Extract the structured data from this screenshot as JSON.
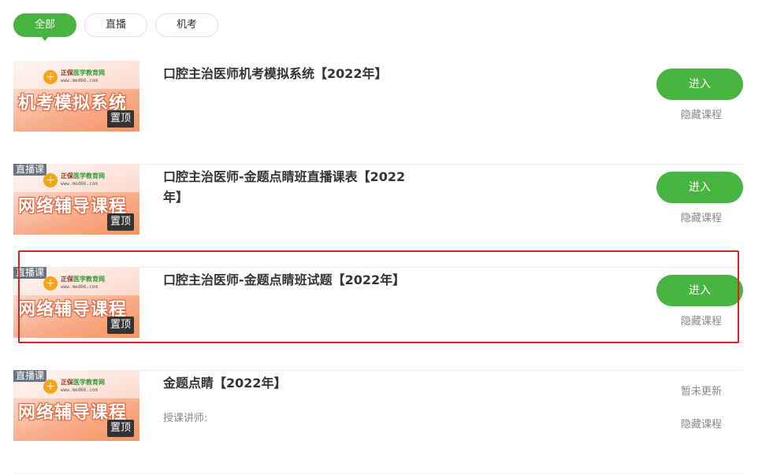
{
  "tabs": [
    {
      "label": "全部",
      "active": true
    },
    {
      "label": "直播",
      "active": false
    },
    {
      "label": "机考",
      "active": false
    }
  ],
  "thumbnail": {
    "logo_text_a": "正保",
    "logo_text_b": "医学教育网",
    "logo_url": "www.med66.com",
    "top_badge": "置顶",
    "live_badge": "直播课"
  },
  "courses": [
    {
      "title": "口腔主治医师机考模拟系统【2022年】",
      "thumb_text": "机考模拟系统",
      "live": false,
      "action": "进入",
      "hide": "隐藏课程"
    },
    {
      "title": "口腔主治医师-金题点睛班直播课表【2022年】",
      "thumb_text": "网络辅导课程",
      "live": true,
      "action": "进入",
      "hide": "隐藏课程"
    },
    {
      "title": "口腔主治医师-金题点睛班试题【2022年】",
      "thumb_text": "网络辅导课程",
      "live": true,
      "action": "进入",
      "hide": "隐藏课程"
    },
    {
      "title": "金题点睛【2022年】",
      "thumb_text": "网络辅导课程",
      "live": true,
      "teacher_label": "授课讲师:",
      "status": "暂未更新",
      "hide": "隐藏课程"
    }
  ],
  "colors": {
    "accent": "#47b53f",
    "highlight_border": "#e02020"
  }
}
